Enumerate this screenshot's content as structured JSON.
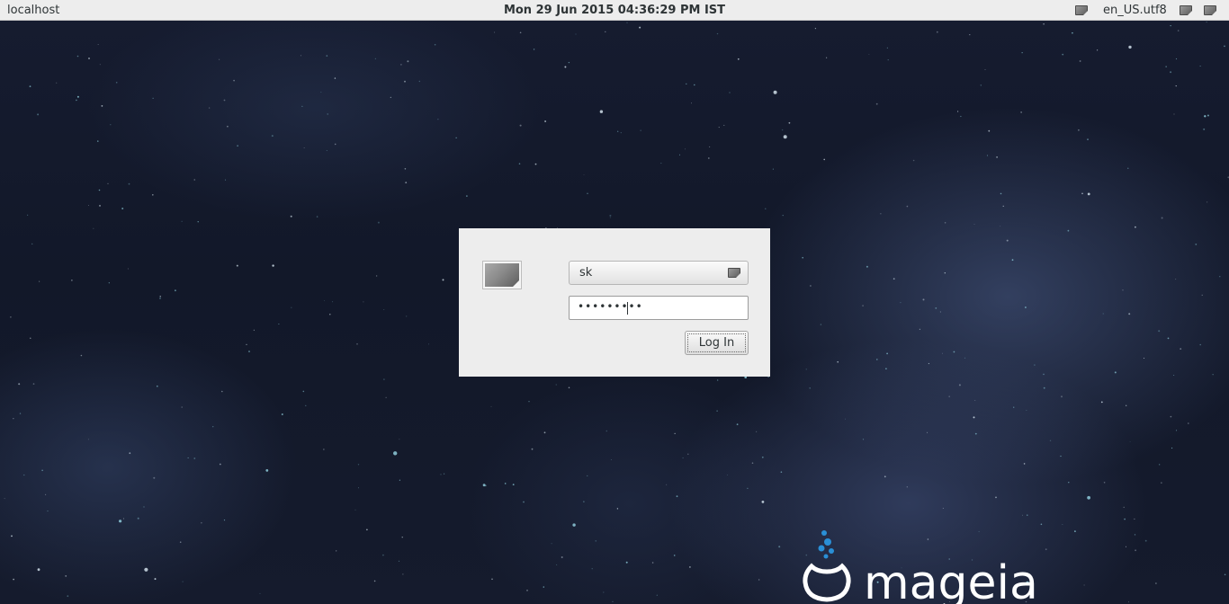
{
  "topbar": {
    "hostname": "localhost",
    "clock": "Mon 29 Jun 2015 04:36:29 PM IST",
    "locale": "en_US.utf8",
    "tray_icons": [
      "display-icon",
      "keyboard-icon",
      "power-icon"
    ]
  },
  "login": {
    "username": "sk",
    "password_masked": "•••••••••",
    "login_button": "Log In",
    "user_icon": "user-avatar-icon"
  },
  "branding": {
    "logo_text": "mageia",
    "accent": "#2a8fd6"
  }
}
